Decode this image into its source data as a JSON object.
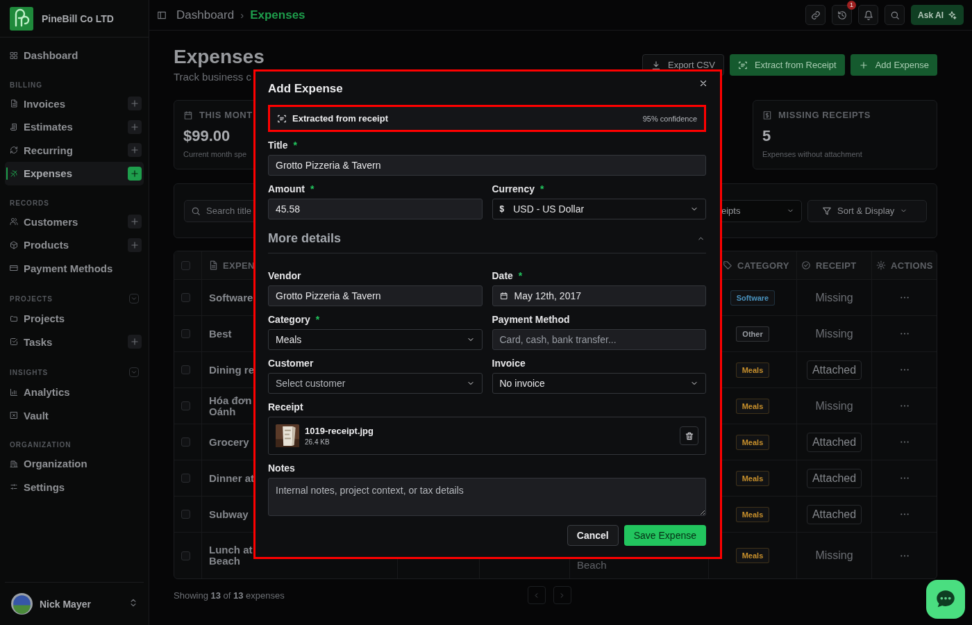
{
  "sidebar": {
    "brand": "PineBill Co LTD",
    "sections": [
      {
        "items": [
          {
            "label": "Dashboard",
            "selected": false,
            "add": false
          }
        ]
      },
      {
        "heading": "BILLING",
        "collapsible": false,
        "items": [
          {
            "label": "Invoices",
            "selected": false,
            "add": true
          },
          {
            "label": "Estimates",
            "selected": false,
            "add": true
          },
          {
            "label": "Recurring",
            "selected": false,
            "add": true
          },
          {
            "label": "Expenses",
            "selected": true,
            "add": true
          }
        ]
      },
      {
        "heading": "RECORDS",
        "collapsible": false,
        "items": [
          {
            "label": "Customers",
            "selected": false,
            "add": true
          },
          {
            "label": "Products",
            "selected": false,
            "add": true
          },
          {
            "label": "Payment Methods",
            "selected": false,
            "add": false
          }
        ]
      },
      {
        "heading": "PROJECTS",
        "collapsible": true,
        "items": [
          {
            "label": "Projects",
            "selected": false,
            "add": false
          },
          {
            "label": "Tasks",
            "selected": false,
            "add": true
          }
        ]
      },
      {
        "heading": "INSIGHTS",
        "collapsible": true,
        "items": [
          {
            "label": "Analytics",
            "selected": false,
            "add": false
          },
          {
            "label": "Vault",
            "selected": false,
            "add": false
          }
        ]
      },
      {
        "heading": "ORGANIZATION",
        "collapsible": false,
        "items": [
          {
            "label": "Organization",
            "selected": false,
            "add": false
          },
          {
            "label": "Settings",
            "selected": false,
            "add": false
          }
        ]
      }
    ],
    "user": {
      "name": "Nick Mayer"
    }
  },
  "topbar": {
    "breadcrumb": [
      {
        "label": "Dashboard",
        "current": false
      },
      {
        "label": "Expenses",
        "current": true
      }
    ],
    "separator": "›",
    "history_badge": "1",
    "ask_ai": "Ask AI"
  },
  "header": {
    "title": "Expenses",
    "subtitle": "Track business c",
    "buttons": [
      {
        "label": "Export CSV",
        "kind": "outline"
      },
      {
        "label": "Extract from Receipt",
        "kind": "green"
      },
      {
        "label": "Add Expense",
        "kind": "green"
      }
    ]
  },
  "stats": [
    {
      "label": "THIS MONT",
      "value": "$99.00",
      "note": "Current month spe"
    },
    {
      "label": "MISSING RECEIPTS",
      "value": "5",
      "note": "Expenses without attachment"
    }
  ],
  "filters": {
    "search_placeholder": "Search title",
    "receipt_filter": "eipts",
    "sort": "Sort & Display"
  },
  "table": {
    "header_checked": false,
    "columns": [
      {
        "label": "EXPEN"
      },
      {
        "label": "CATEGORY"
      },
      {
        "label": "RECEIPT"
      },
      {
        "label": "ACTIONS"
      }
    ],
    "rows": [
      {
        "checked": false,
        "title": "Software",
        "category": "Software",
        "color": "#4a94c0",
        "receipt": "Missing",
        "attached": false
      },
      {
        "checked": false,
        "title": "Best",
        "category": "Other",
        "color": "#9a9ea4",
        "receipt": "Missing",
        "attached": false
      },
      {
        "checked": false,
        "title": "Dining re",
        "category": "Meals",
        "color": "#c8902c",
        "receipt": "Attached",
        "attached": true
      },
      {
        "checked": false,
        "title": "Hóa đơn\nOánh",
        "category": "Meals",
        "color": "#c8902c",
        "receipt": "Missing",
        "attached": false
      },
      {
        "checked": false,
        "title": "Grocery",
        "category": "Meals",
        "color": "#c8902c",
        "receipt": "Attached",
        "attached": true
      },
      {
        "checked": false,
        "title": "Dinner at",
        "category": "Meals",
        "color": "#c8902c",
        "receipt": "Attached",
        "attached": true
      },
      {
        "checked": false,
        "title": "Subway",
        "category": "Meals",
        "color": "#c8902c",
        "receipt": "Attached",
        "attached": true
      },
      {
        "checked": false,
        "title": "Lunch at\nBeach",
        "column_4": "Beach",
        "category": "Meals",
        "color": "#c8902c",
        "receipt": "Missing",
        "attached": false
      }
    ],
    "footer": "Showing **13** of **13** expenses"
  },
  "modal": {
    "title": "Add Expense",
    "highlighted": true,
    "banner": {
      "text": "Extracted from receipt",
      "confidence": "95% confidence",
      "highlighted": true
    },
    "top_rows": [
      [
        {
          "label": "Title",
          "required": true,
          "kind": "input",
          "value": "Grotto Pizzeria & Tavern"
        }
      ],
      [
        {
          "label": "Amount",
          "required": true,
          "kind": "input",
          "value": "45.58"
        },
        {
          "label": "Currency",
          "required": true,
          "kind": "select",
          "prefix": "$",
          "value": "USD - US Dollar"
        }
      ]
    ],
    "more": {
      "label": "More details",
      "expanded": true
    },
    "more_rows": [
      [
        {
          "label": "Vendor",
          "required": false,
          "kind": "input",
          "value": "Grotto Pizzeria & Tavern"
        },
        {
          "label": "Date",
          "required": true,
          "kind": "date",
          "value": "May 12th, 2017"
        }
      ],
      [
        {
          "label": "Category",
          "required": true,
          "kind": "select",
          "value": "Meals"
        },
        {
          "label": "Payment Method",
          "required": false,
          "kind": "input",
          "placeholder": "Card, cash, bank transfer..."
        }
      ],
      [
        {
          "label": "Customer",
          "required": false,
          "kind": "select",
          "placeholder": "Select customer"
        },
        {
          "label": "Invoice",
          "required": false,
          "kind": "select",
          "value": "No invoice"
        }
      ]
    ],
    "required_mark": "*",
    "receipt": {
      "label": "Receipt",
      "file": "1019-receipt.jpg",
      "size": "26.4 KB"
    },
    "notes": {
      "label": "Notes",
      "placeholder": "Internal notes, project context, or tax details"
    },
    "buttons": [
      {
        "label": "Cancel",
        "kind": "secondary"
      },
      {
        "label": "Save Expense",
        "kind": "primary"
      }
    ]
  }
}
